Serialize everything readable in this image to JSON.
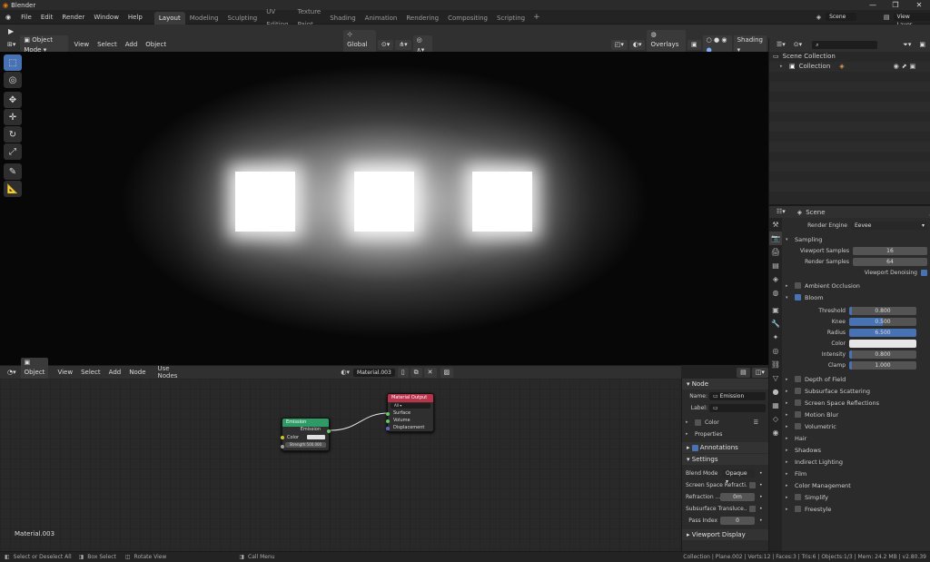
{
  "window": {
    "title": "Blender"
  },
  "menu": [
    "File",
    "Edit",
    "Render",
    "Window",
    "Help"
  ],
  "workspaces": [
    "Layout",
    "Modeling",
    "Sculpting",
    "UV Editing",
    "Texture Paint",
    "Shading",
    "Animation",
    "Rendering",
    "Compositing",
    "Scripting"
  ],
  "active_workspace": "Layout",
  "scene": {
    "name": "Scene",
    "view_layer": "View Layer"
  },
  "viewport_header": {
    "mode": "Object Mode",
    "menus": [
      "View",
      "Select",
      "Add",
      "Object"
    ],
    "orientation": "Global",
    "overlays": "Overlays",
    "shading": "Shading"
  },
  "node_header": {
    "type": "Object",
    "menus": [
      "View",
      "Select",
      "Add",
      "Node"
    ],
    "use_nodes": "Use Nodes",
    "material": "Material.003"
  },
  "nodes": {
    "emission": {
      "title": "Emission",
      "output": "Emission",
      "color_label": "Color",
      "strength": "Strength:500.000"
    },
    "output": {
      "title": "Material Output",
      "target": "All",
      "sockets": [
        "Surface",
        "Volume",
        "Displacement"
      ]
    }
  },
  "node_editor_label": "Material.003",
  "npanel": {
    "node_section": "Node",
    "name_label": "Name:",
    "name_value": "Emission",
    "label_label": "Label:",
    "color": "Color",
    "properties": "Properties",
    "annotations": "Annotations",
    "settings": "Settings",
    "blend_mode_label": "Blend Mode",
    "blend_mode": "Opaque",
    "ssr_label": "Screen Space Refracti...",
    "refraction_label": "Refraction ...",
    "refraction_value": "0m",
    "sss_label": "Subsurface Transluce...",
    "pass_index_label": "Pass Index",
    "pass_index": "0",
    "viewport_display": "Viewport Display"
  },
  "outliner": {
    "scene_collection": "Scene Collection",
    "collection": "Collection"
  },
  "properties": {
    "scene_label": "Scene",
    "render_engine_label": "Render Engine",
    "render_engine": "Eevee",
    "sampling": "Sampling",
    "viewport_samples_label": "Viewport Samples",
    "viewport_samples": "16",
    "render_samples_label": "Render Samples",
    "render_samples": "64",
    "viewport_denoising": "Viewport Denoising",
    "ambient_occlusion": "Ambient Occlusion",
    "bloom": "Bloom",
    "threshold_label": "Threshold",
    "threshold": "0.800",
    "knee_label": "Knee",
    "knee": "0.500",
    "radius_label": "Radius",
    "radius": "6.500",
    "color_label": "Color",
    "intensity_label": "Intensity",
    "intensity": "0.800",
    "clamp_label": "Clamp",
    "clamp": "1.000",
    "sections": [
      "Depth of Field",
      "Subsurface Scattering",
      "Screen Space Reflections",
      "Motion Blur",
      "Volumetric",
      "Hair",
      "Shadows",
      "Indirect Lighting",
      "Film",
      "Color Management",
      "Simplify",
      "Freestyle"
    ]
  },
  "status": {
    "left1": "Select or Deselect All",
    "left2": "Box Select",
    "left3": "Rotate View",
    "left4": "Call Menu",
    "right": "Collection | Plane.002 | Verts:12 | Faces:3 | Tris:6 | Objects:1/3 | Mem: 24.2 MB | v2.80.39"
  },
  "colors": {
    "accent": "#4772b3",
    "emission_header": "#2e9a66",
    "output_header": "#b8324a"
  }
}
